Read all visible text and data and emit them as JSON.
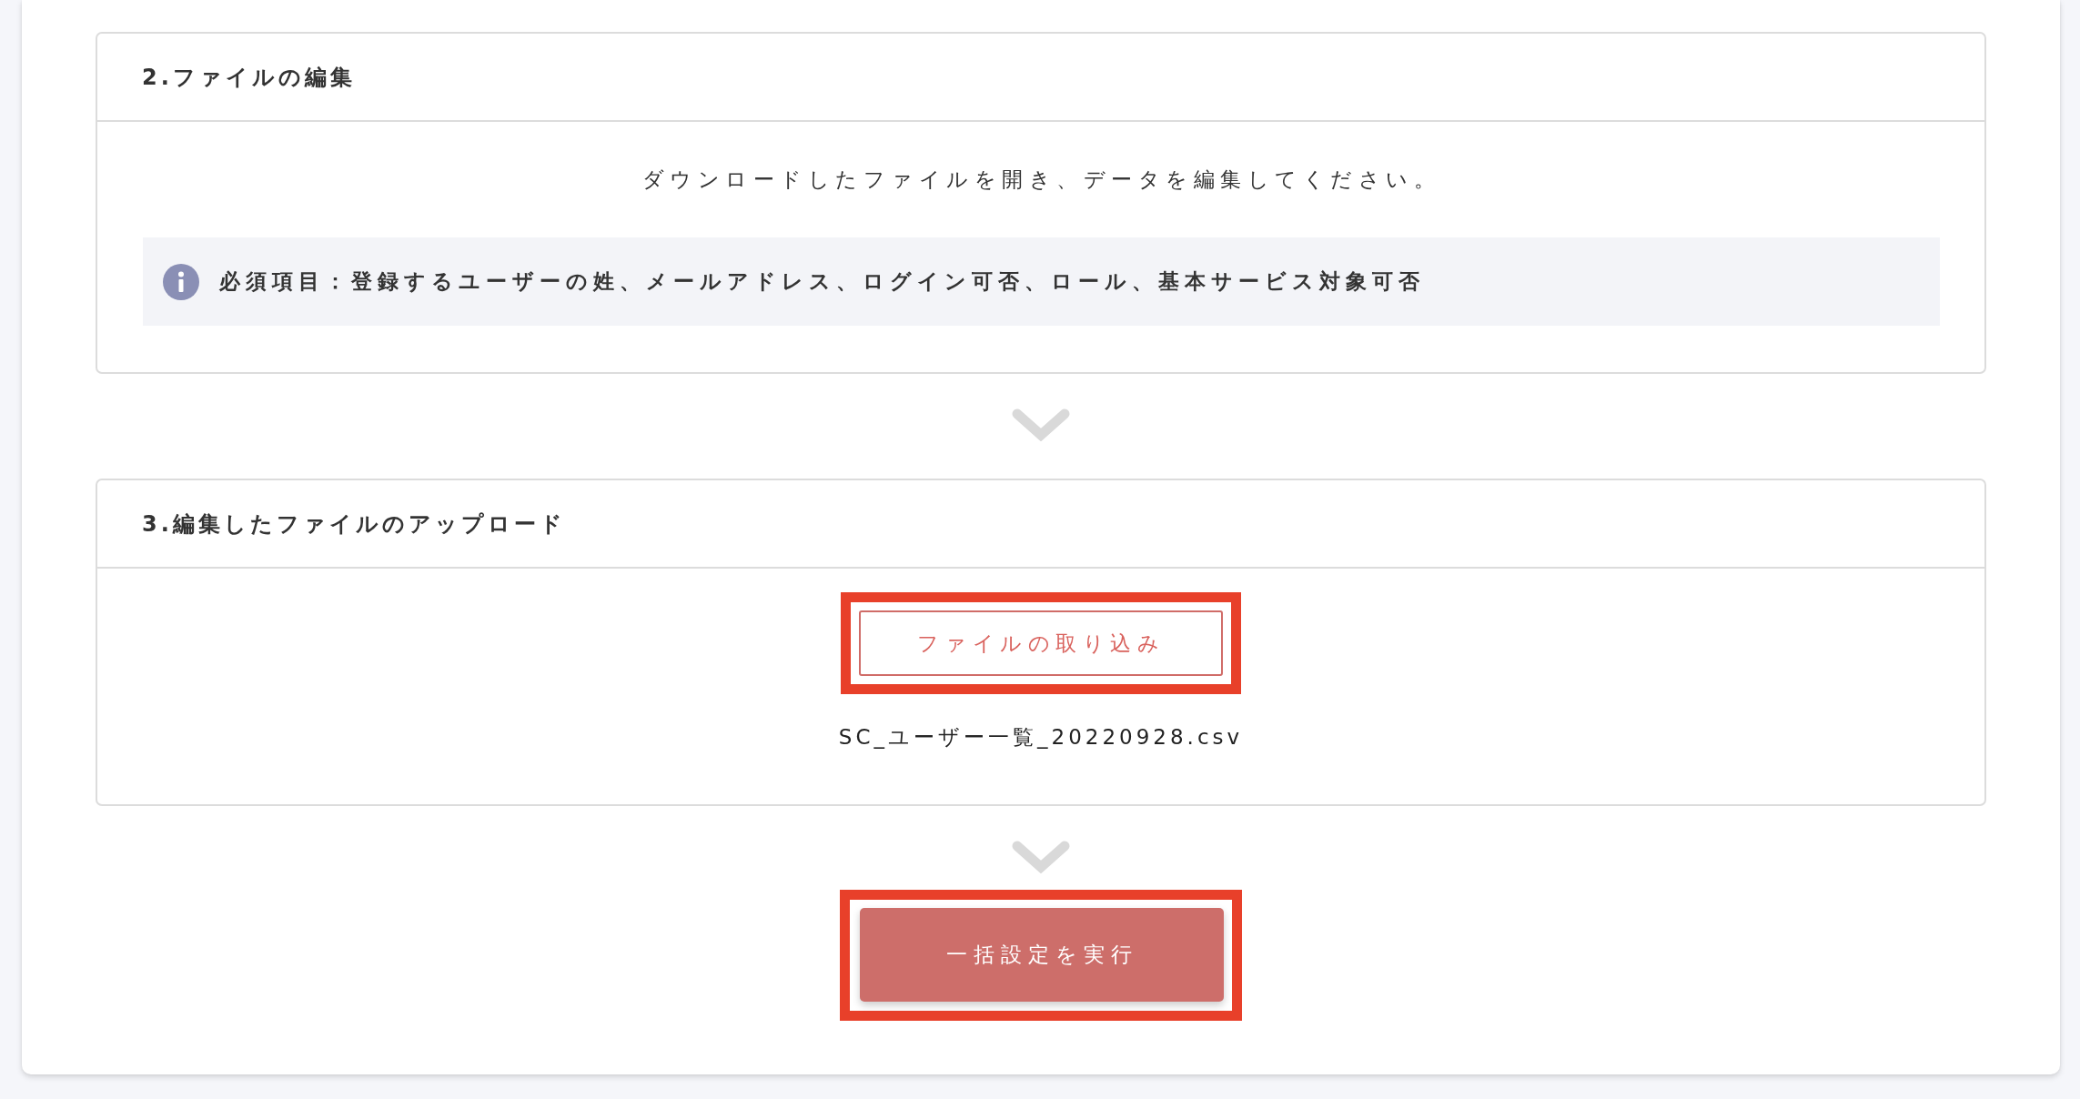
{
  "sections": [
    {
      "title": "2.ファイルの編集",
      "description": "ダウンロードしたファイルを開き、データを編集してください。",
      "note": "必須項目：登録するユーザーの姓、メールアドレス、ログイン可否、ロール、基本サービス対象可否"
    },
    {
      "title": "3.編集したファイルのアップロード",
      "import_button": {
        "label": "ファイルの取り込み",
        "highlighted": true
      },
      "file_name": "SC_ユーザー一覧_20220928.csv"
    }
  ],
  "execute_button": {
    "label": "一括設定を実行",
    "highlighted": true
  }
}
